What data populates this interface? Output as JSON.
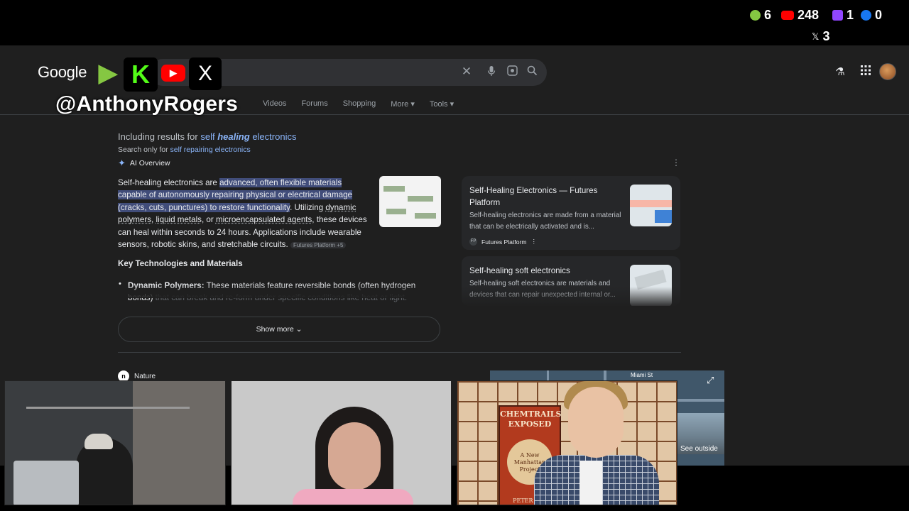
{
  "stream_stats": {
    "rumble": "6",
    "youtube": "248",
    "twitch": "1",
    "facebook": "0",
    "x": "3",
    "x_glyph": "𝕏"
  },
  "google": {
    "logo": "Google",
    "tabs": [
      "Videos",
      "Forums",
      "Shopping",
      "More",
      "Tools"
    ],
    "tab_more_chevron": "▾",
    "tab_tools_chevron": "▾",
    "including_prefix": "Including results for ",
    "including_term_a": "self ",
    "including_term_b": "healing",
    "including_term_c": " electronics",
    "search_only_prefix": "Search only for ",
    "search_only_term": "self repairing electronics",
    "ai_overview": "AI Overview",
    "overview": {
      "p1": "Self-healing electronics are ",
      "p2_highlight": "advanced, often flexible materials capable of autonomously repairing physical or electrical damage (cracks, cuts, punctures) to restore functionality",
      "p3": ". Utilizing ",
      "p4_link": "dynamic polymers",
      "p5": ", ",
      "p6_link": "liquid metals",
      "p7": ", or ",
      "p8_link": "microencapsulated agents",
      "p9": ", these devices can heal within seconds to 24 hours. Applications include wearable sensors, robotic skins, and stretchable circuits.",
      "chip": "Futures Platform +5"
    },
    "key_heading": "Key Technologies and Materials",
    "bullet_bold": "Dynamic Polymers:",
    "bullet_text": " These materials feature reversible bonds (often hydrogen bonds) ",
    "bullet_fade": "that can break and re-form under specific conditions like heat or light.",
    "show_more": "Show more",
    "sources": [
      {
        "title": "Self-Healing Electronics — Futures Platform",
        "snippet": "Self-healing electronics are made from a material that can be electrically activated and is...",
        "site": "Futures Platform",
        "favicon": "FP"
      },
      {
        "title": "Self-healing soft electronics",
        "snippet": "Self-healing soft electronics are materials and devices that can repair unexpected internal or..."
      }
    ],
    "nature": "Nature",
    "nature_logo": "n",
    "map_label": "Miami St",
    "see_outside": "See outside"
  },
  "overlay": {
    "handle": "@AnthonyRogers",
    "kick": "K",
    "x": "X"
  },
  "book": {
    "title": "CHEMTRAILS EXPOSED",
    "subtitle": "A New Manhattan Project",
    "author": "PETER A. K"
  }
}
